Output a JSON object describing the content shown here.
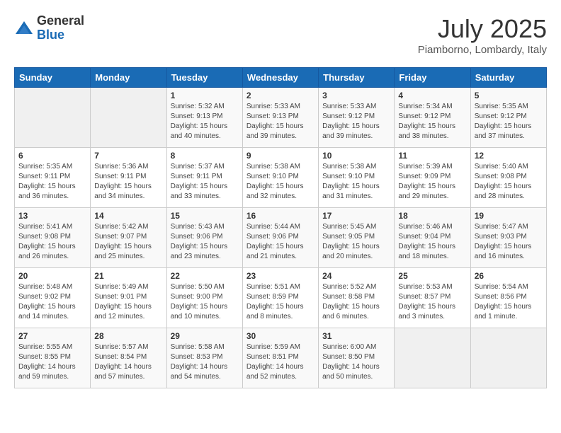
{
  "logo": {
    "general": "General",
    "blue": "Blue"
  },
  "header": {
    "month": "July 2025",
    "location": "Piamborno, Lombardy, Italy"
  },
  "weekdays": [
    "Sunday",
    "Monday",
    "Tuesday",
    "Wednesday",
    "Thursday",
    "Friday",
    "Saturday"
  ],
  "weeks": [
    [
      {
        "day": "",
        "info": ""
      },
      {
        "day": "",
        "info": ""
      },
      {
        "day": "1",
        "info": "Sunrise: 5:32 AM\nSunset: 9:13 PM\nDaylight: 15 hours\nand 40 minutes."
      },
      {
        "day": "2",
        "info": "Sunrise: 5:33 AM\nSunset: 9:13 PM\nDaylight: 15 hours\nand 39 minutes."
      },
      {
        "day": "3",
        "info": "Sunrise: 5:33 AM\nSunset: 9:12 PM\nDaylight: 15 hours\nand 39 minutes."
      },
      {
        "day": "4",
        "info": "Sunrise: 5:34 AM\nSunset: 9:12 PM\nDaylight: 15 hours\nand 38 minutes."
      },
      {
        "day": "5",
        "info": "Sunrise: 5:35 AM\nSunset: 9:12 PM\nDaylight: 15 hours\nand 37 minutes."
      }
    ],
    [
      {
        "day": "6",
        "info": "Sunrise: 5:35 AM\nSunset: 9:11 PM\nDaylight: 15 hours\nand 36 minutes."
      },
      {
        "day": "7",
        "info": "Sunrise: 5:36 AM\nSunset: 9:11 PM\nDaylight: 15 hours\nand 34 minutes."
      },
      {
        "day": "8",
        "info": "Sunrise: 5:37 AM\nSunset: 9:11 PM\nDaylight: 15 hours\nand 33 minutes."
      },
      {
        "day": "9",
        "info": "Sunrise: 5:38 AM\nSunset: 9:10 PM\nDaylight: 15 hours\nand 32 minutes."
      },
      {
        "day": "10",
        "info": "Sunrise: 5:38 AM\nSunset: 9:10 PM\nDaylight: 15 hours\nand 31 minutes."
      },
      {
        "day": "11",
        "info": "Sunrise: 5:39 AM\nSunset: 9:09 PM\nDaylight: 15 hours\nand 29 minutes."
      },
      {
        "day": "12",
        "info": "Sunrise: 5:40 AM\nSunset: 9:08 PM\nDaylight: 15 hours\nand 28 minutes."
      }
    ],
    [
      {
        "day": "13",
        "info": "Sunrise: 5:41 AM\nSunset: 9:08 PM\nDaylight: 15 hours\nand 26 minutes."
      },
      {
        "day": "14",
        "info": "Sunrise: 5:42 AM\nSunset: 9:07 PM\nDaylight: 15 hours\nand 25 minutes."
      },
      {
        "day": "15",
        "info": "Sunrise: 5:43 AM\nSunset: 9:06 PM\nDaylight: 15 hours\nand 23 minutes."
      },
      {
        "day": "16",
        "info": "Sunrise: 5:44 AM\nSunset: 9:06 PM\nDaylight: 15 hours\nand 21 minutes."
      },
      {
        "day": "17",
        "info": "Sunrise: 5:45 AM\nSunset: 9:05 PM\nDaylight: 15 hours\nand 20 minutes."
      },
      {
        "day": "18",
        "info": "Sunrise: 5:46 AM\nSunset: 9:04 PM\nDaylight: 15 hours\nand 18 minutes."
      },
      {
        "day": "19",
        "info": "Sunrise: 5:47 AM\nSunset: 9:03 PM\nDaylight: 15 hours\nand 16 minutes."
      }
    ],
    [
      {
        "day": "20",
        "info": "Sunrise: 5:48 AM\nSunset: 9:02 PM\nDaylight: 15 hours\nand 14 minutes."
      },
      {
        "day": "21",
        "info": "Sunrise: 5:49 AM\nSunset: 9:01 PM\nDaylight: 15 hours\nand 12 minutes."
      },
      {
        "day": "22",
        "info": "Sunrise: 5:50 AM\nSunset: 9:00 PM\nDaylight: 15 hours\nand 10 minutes."
      },
      {
        "day": "23",
        "info": "Sunrise: 5:51 AM\nSunset: 8:59 PM\nDaylight: 15 hours\nand 8 minutes."
      },
      {
        "day": "24",
        "info": "Sunrise: 5:52 AM\nSunset: 8:58 PM\nDaylight: 15 hours\nand 6 minutes."
      },
      {
        "day": "25",
        "info": "Sunrise: 5:53 AM\nSunset: 8:57 PM\nDaylight: 15 hours\nand 3 minutes."
      },
      {
        "day": "26",
        "info": "Sunrise: 5:54 AM\nSunset: 8:56 PM\nDaylight: 15 hours\nand 1 minute."
      }
    ],
    [
      {
        "day": "27",
        "info": "Sunrise: 5:55 AM\nSunset: 8:55 PM\nDaylight: 14 hours\nand 59 minutes."
      },
      {
        "day": "28",
        "info": "Sunrise: 5:57 AM\nSunset: 8:54 PM\nDaylight: 14 hours\nand 57 minutes."
      },
      {
        "day": "29",
        "info": "Sunrise: 5:58 AM\nSunset: 8:53 PM\nDaylight: 14 hours\nand 54 minutes."
      },
      {
        "day": "30",
        "info": "Sunrise: 5:59 AM\nSunset: 8:51 PM\nDaylight: 14 hours\nand 52 minutes."
      },
      {
        "day": "31",
        "info": "Sunrise: 6:00 AM\nSunset: 8:50 PM\nDaylight: 14 hours\nand 50 minutes."
      },
      {
        "day": "",
        "info": ""
      },
      {
        "day": "",
        "info": ""
      }
    ]
  ]
}
